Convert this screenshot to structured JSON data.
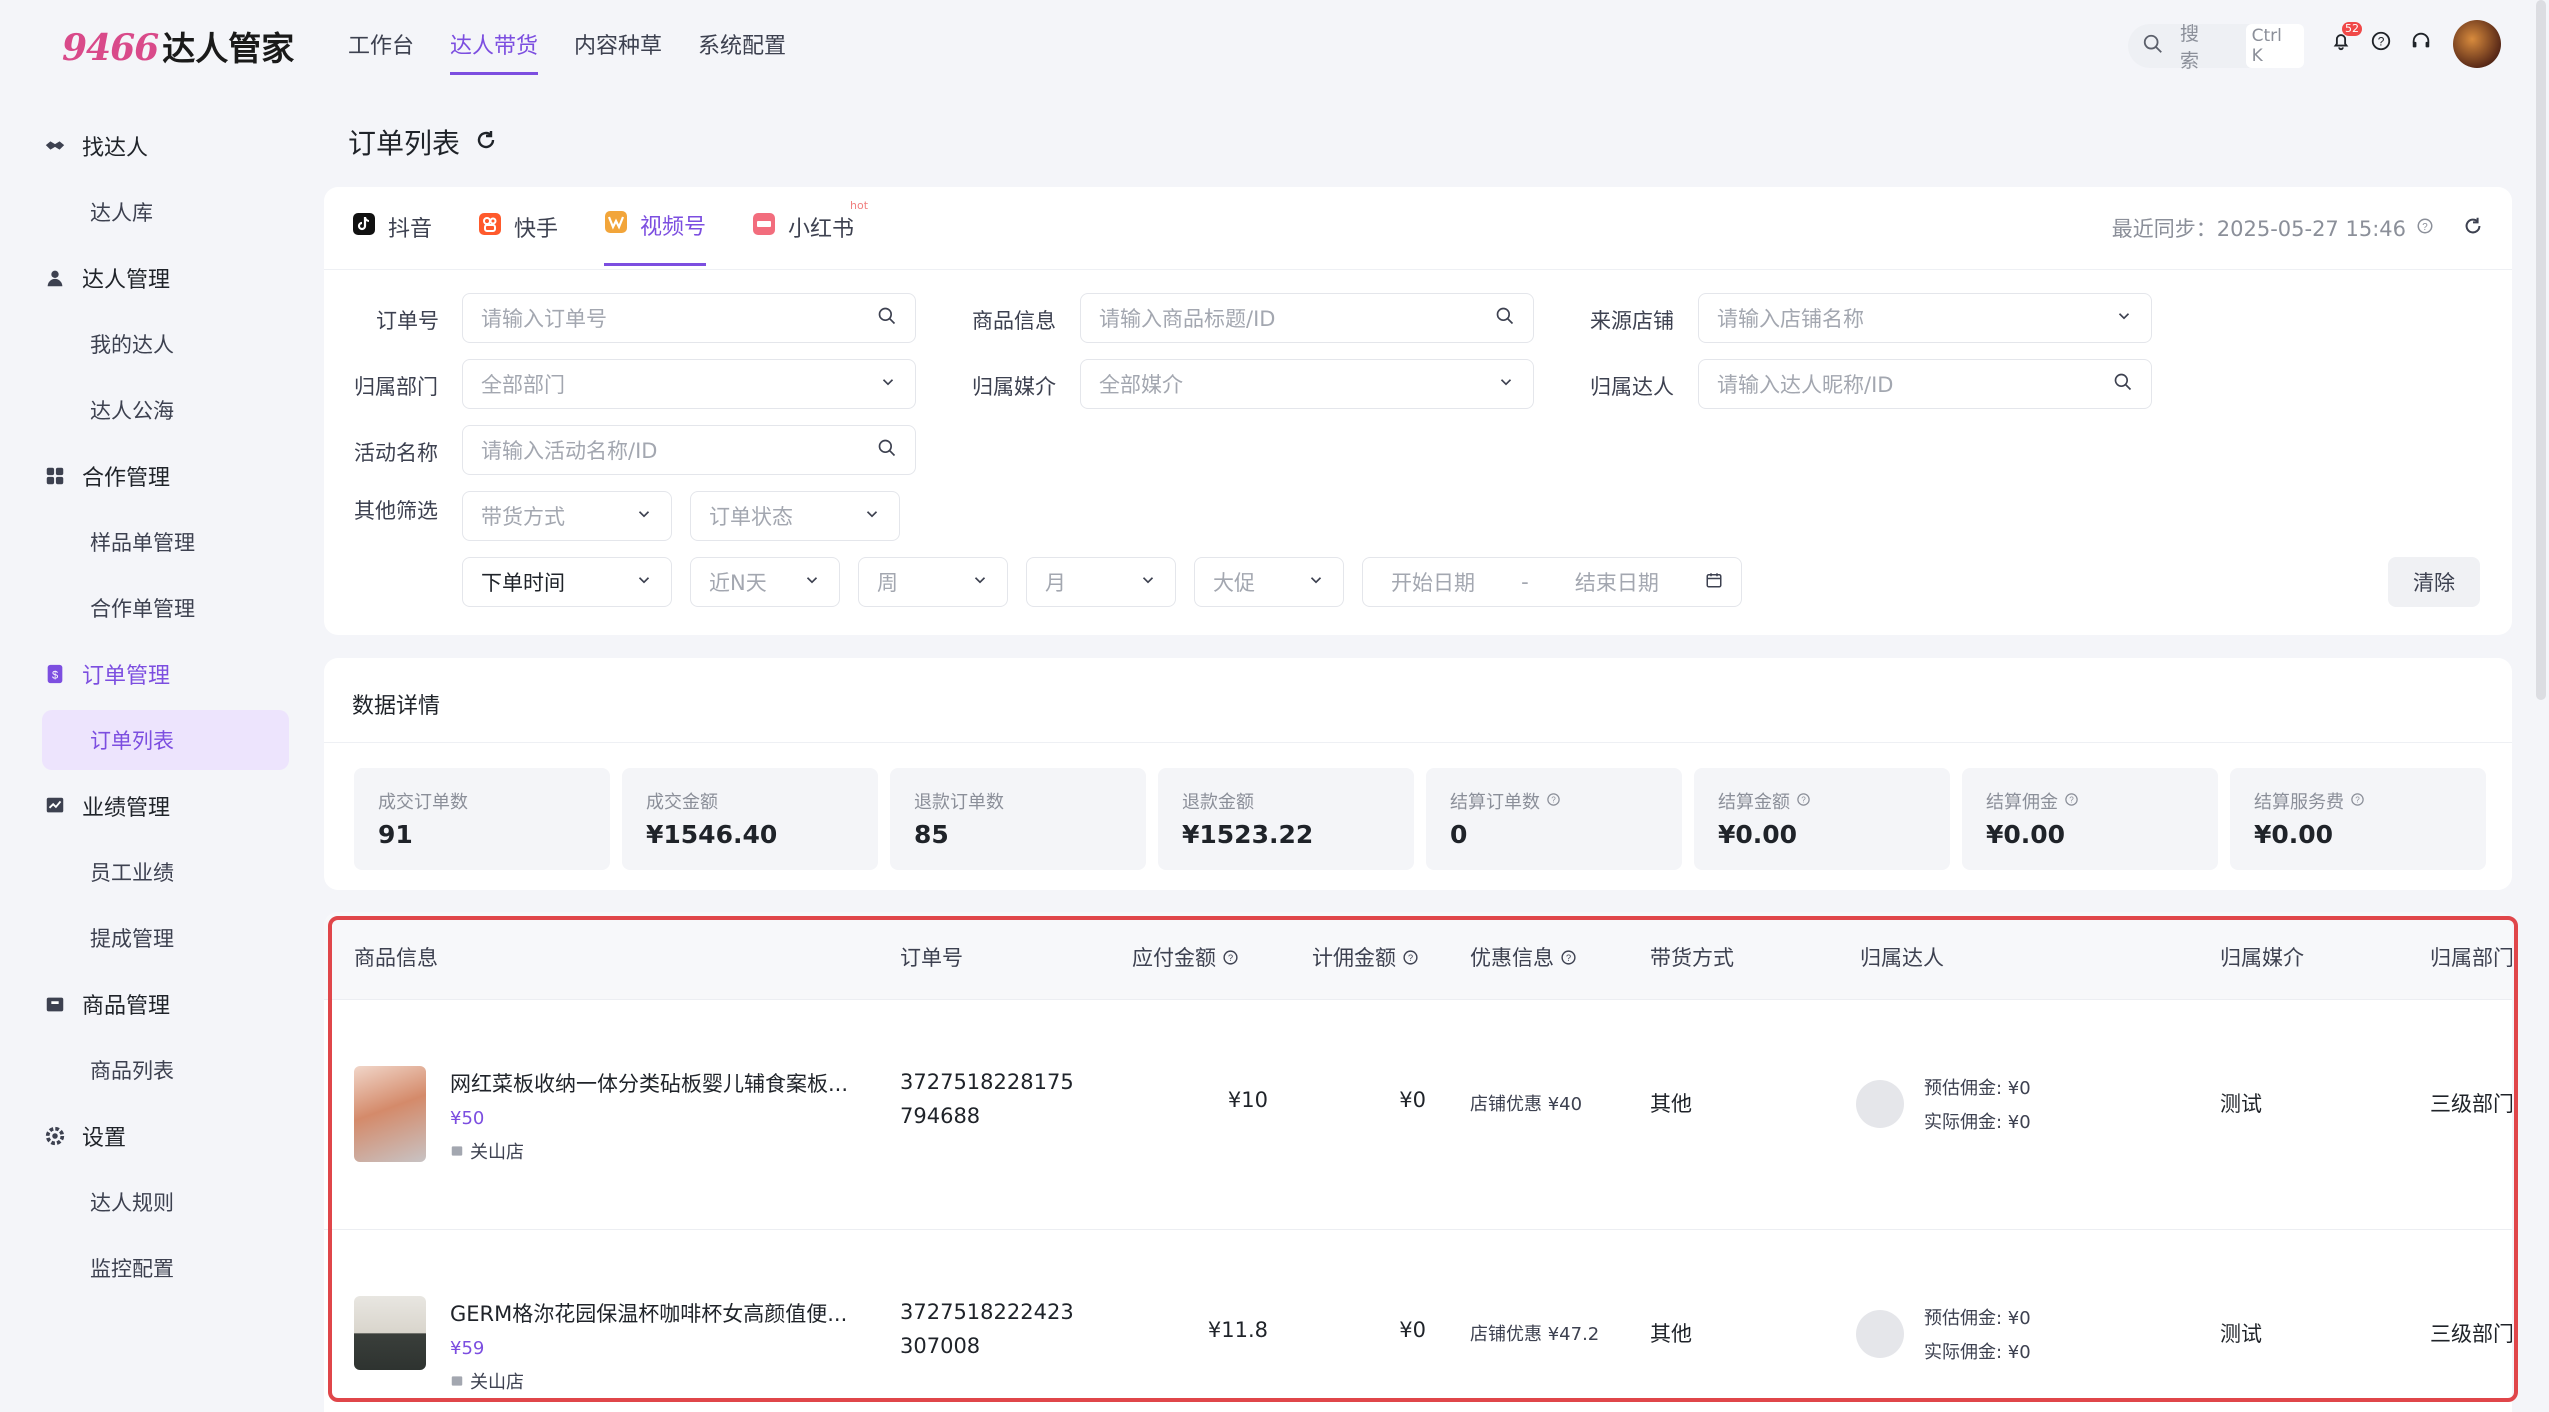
{
  "logo": {
    "number": "9466",
    "text": "达人管家"
  },
  "topnav": [
    "工作台",
    "达人带货",
    "内容种草",
    "系统配置"
  ],
  "search": {
    "label": "搜索",
    "shortcut": "Ctrl K"
  },
  "notify_badge": "52",
  "sidebar": {
    "groups": [
      {
        "label": "找达人",
        "icon": "handshake-icon",
        "items": [
          "达人库"
        ]
      },
      {
        "label": "达人管理",
        "icon": "user-icon",
        "items": [
          "我的达人",
          "达人公海"
        ]
      },
      {
        "label": "合作管理",
        "icon": "grid-icon",
        "items": [
          "样品单管理",
          "合作单管理"
        ]
      },
      {
        "label": "订单管理",
        "icon": "order-icon",
        "items": [
          "订单列表"
        ]
      },
      {
        "label": "业绩管理",
        "icon": "chart-icon",
        "items": [
          "员工业绩",
          "提成管理"
        ]
      },
      {
        "label": "商品管理",
        "icon": "box-icon",
        "items": [
          "商品列表"
        ]
      },
      {
        "label": "设置",
        "icon": "gear-icon",
        "items": [
          "达人规则",
          "监控配置"
        ]
      }
    ]
  },
  "page": {
    "title": "订单列表"
  },
  "platform_tabs": [
    {
      "label": "抖音",
      "color": "#111111"
    },
    {
      "label": "快手",
      "color": "#ff5a2c"
    },
    {
      "label": "视频号",
      "color": "#f2a53a"
    },
    {
      "label": "小红书",
      "color": "#f26d7d",
      "hot": "hot"
    }
  ],
  "sync": {
    "label": "最近同步：2025-05-27 15:46"
  },
  "filters": {
    "order_no": {
      "label": "订单号",
      "placeholder": "请输入订单号"
    },
    "product": {
      "label": "商品信息",
      "placeholder": "请输入商品标题/ID"
    },
    "shop": {
      "label": "来源店铺",
      "placeholder": "请输入店铺名称"
    },
    "dept": {
      "label": "归属部门",
      "placeholder": "全部部门"
    },
    "media": {
      "label": "归属媒介",
      "placeholder": "全部媒介"
    },
    "talent": {
      "label": "归属达人",
      "placeholder": "请输入达人昵称/ID"
    },
    "activity": {
      "label": "活动名称",
      "placeholder": "请输入活动名称/ID"
    },
    "other_label": "其他筛选",
    "sell_mode": "带货方式",
    "order_status": "订单状态",
    "time_type": "下单时间",
    "recent_days": "近N天",
    "week": "周",
    "month": "月",
    "promo": "大促",
    "start_date": "开始日期",
    "date_sep": "-",
    "end_date": "结束日期",
    "clear": "清除"
  },
  "stats": {
    "title": "数据详情",
    "items": [
      {
        "label": "成交订单数",
        "value": "91",
        "help": false
      },
      {
        "label": "成交金额",
        "value": "¥1546.40",
        "help": false
      },
      {
        "label": "退款订单数",
        "value": "85",
        "help": false
      },
      {
        "label": "退款金额",
        "value": "¥1523.22",
        "help": false
      },
      {
        "label": "结算订单数",
        "value": "0",
        "help": true
      },
      {
        "label": "结算金额",
        "value": "¥0.00",
        "help": true
      },
      {
        "label": "结算佣金",
        "value": "¥0.00",
        "help": true
      },
      {
        "label": "结算服务费",
        "value": "¥0.00",
        "help": true
      }
    ]
  },
  "table": {
    "headers": [
      "商品信息",
      "订单号",
      "应付金额",
      "计佣金额",
      "优惠信息",
      "带货方式",
      "归属达人",
      "归属媒介",
      "归属部门"
    ],
    "rows": [
      {
        "name": "网红菜板收纳一体分类砧板婴儿辅食案板...",
        "price": "¥50",
        "shop": "关山店",
        "order_no_1": "3727518228175",
        "order_no_2": "794688",
        "payable": "¥10",
        "commission_base": "¥0",
        "discount": "店铺优惠 ¥40",
        "mode": "其他",
        "est_comm": "预估佣金: ¥0",
        "act_comm": "实际佣金: ¥0",
        "media": "测试",
        "dept": "三级部门"
      },
      {
        "name": "GERM格沵花园保温杯咖啡杯女高颜值便...",
        "price": "¥59",
        "shop": "关山店",
        "order_no_1": "3727518222423",
        "order_no_2": "307008",
        "payable": "¥11.8",
        "commission_base": "¥0",
        "discount": "店铺优惠 ¥47.2",
        "mode": "其他",
        "est_comm": "预估佣金: ¥0",
        "act_comm": "实际佣金: ¥0",
        "media": "测试",
        "dept": "三级部门"
      }
    ]
  },
  "colors": {
    "accent": "#7c4ee0",
    "highlight": "#e0464a"
  }
}
